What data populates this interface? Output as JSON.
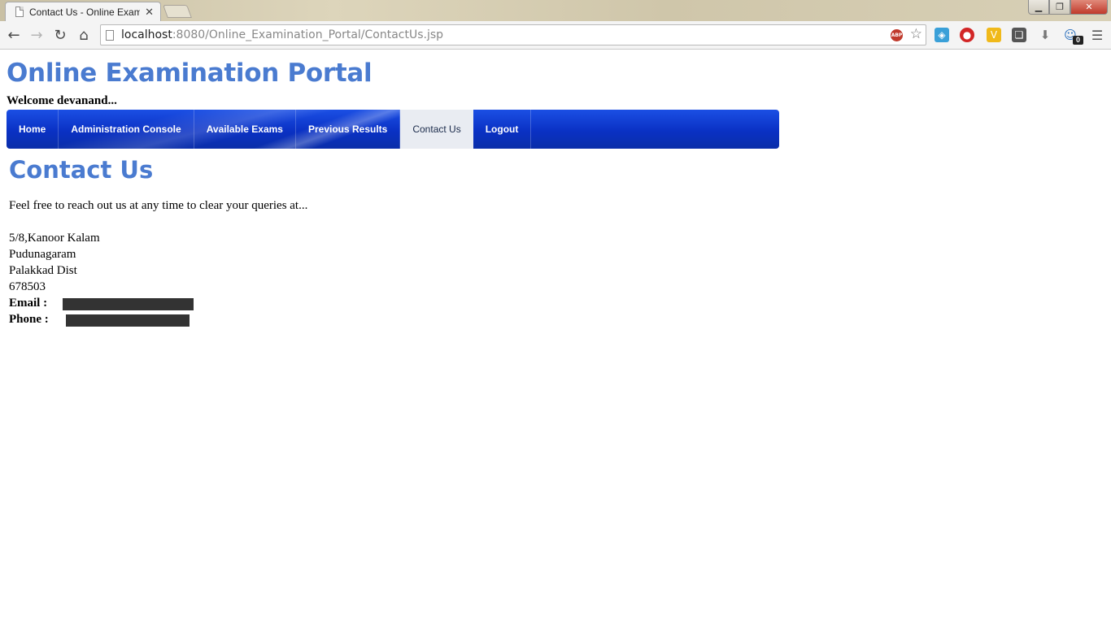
{
  "browser": {
    "tab_title": "Contact Us - Online Exami",
    "tab_close": "✕",
    "url_host": "localhost",
    "url_rest": ":8080/Online_Examination_Portal/ContactUs.jsp",
    "window_controls": {
      "minimize": "▁",
      "maximize": "❐",
      "close": "✕"
    },
    "nav": {
      "back": "←",
      "forward": "→",
      "reload": "↻",
      "home": "⌂"
    },
    "extensions": [
      {
        "icon": "pocket-icon",
        "glyph": "◈"
      },
      {
        "icon": "stop-icon",
        "glyph": "●"
      },
      {
        "icon": "v-icon",
        "glyph": "V"
      },
      {
        "icon": "evernote-icon",
        "glyph": "❏"
      },
      {
        "icon": "download-icon",
        "glyph": "⬇"
      },
      {
        "icon": "skype-icon",
        "glyph": "☺"
      }
    ],
    "extension_badge": "0",
    "abp_label": "ABP",
    "star_glyph": "☆",
    "menu_glyph": "☰"
  },
  "site": {
    "title": "Online Examination Portal",
    "welcome": "Welcome devanand..."
  },
  "menu": {
    "items": [
      {
        "label": "Home",
        "active": false
      },
      {
        "label": "Administration Console",
        "active": false
      },
      {
        "label": "Available Exams",
        "active": false
      },
      {
        "label": "Previous Results",
        "active": false
      },
      {
        "label": "Contact Us",
        "active": true
      },
      {
        "label": "Logout",
        "active": false
      }
    ]
  },
  "content": {
    "heading": "Contact Us",
    "intro": "Feel free to reach out us at any time to clear your queries at...",
    "address": [
      "5/8,Kanoor Kalam",
      "Pudunagaram",
      "Palakkad Dist",
      "678503"
    ],
    "email_label": "Email :",
    "phone_label": "Phone :"
  },
  "colors": {
    "title_blue": "#4a7bd0",
    "menu_blue": "#0a31c4",
    "active_tab_bg": "#e9ecf2",
    "redaction": "#333333"
  }
}
